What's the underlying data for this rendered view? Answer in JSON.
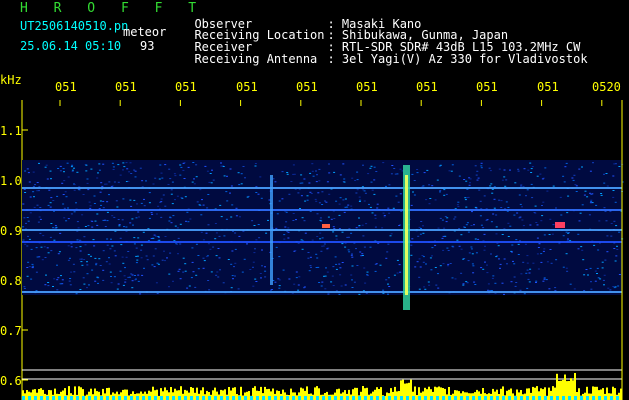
{
  "header": {
    "logo": "H R O F F T",
    "filename": "UT2506140510.pn",
    "meteor_label": "meteor",
    "datetime": "25.06.14 05:10",
    "count": "93"
  },
  "info": [
    {
      "label": "Observer",
      "value": ": Masaki Kano"
    },
    {
      "label": "Receiving Location",
      "value": ": Shibukawa, Gunma, Japan"
    },
    {
      "label": "Receiver",
      "value": ": RTL-SDR SDR# 43dB L15 103.2MHz CW"
    },
    {
      "label": "Receiving Antenna",
      "value": ": 3el Yagi(V) Az 330 for Vladivostok"
    }
  ],
  "axis": {
    "unit": "kHz",
    "y_ticks": [
      "1.1",
      "1.0",
      "0.9",
      "0.8",
      "0.7",
      "0.6"
    ],
    "x_ticks": [
      "051",
      "051",
      "051",
      "051",
      "051",
      "051",
      "051",
      "051",
      "051",
      "0520"
    ]
  },
  "colors": {
    "background": "#000000",
    "grid": "#ffffff",
    "labels": "#ffff00",
    "info": "#ffffff"
  }
}
